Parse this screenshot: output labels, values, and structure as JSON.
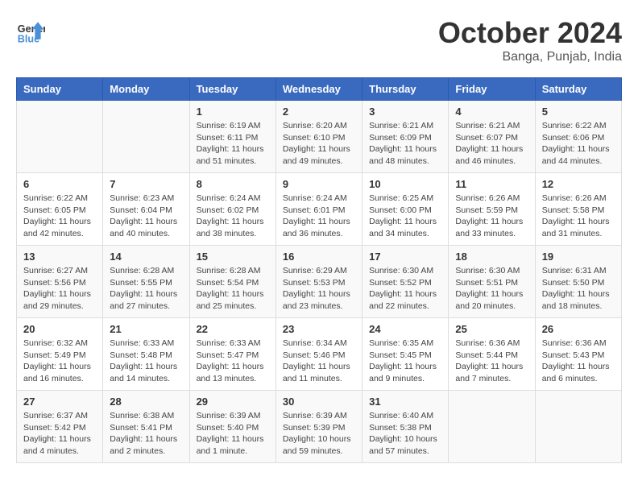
{
  "header": {
    "logo_line1": "General",
    "logo_line2": "Blue",
    "month": "October 2024",
    "location": "Banga, Punjab, India"
  },
  "weekdays": [
    "Sunday",
    "Monday",
    "Tuesday",
    "Wednesday",
    "Thursday",
    "Friday",
    "Saturday"
  ],
  "weeks": [
    [
      {
        "day": "",
        "sunrise": "",
        "sunset": "",
        "daylight": ""
      },
      {
        "day": "",
        "sunrise": "",
        "sunset": "",
        "daylight": ""
      },
      {
        "day": "1",
        "sunrise": "Sunrise: 6:19 AM",
        "sunset": "Sunset: 6:11 PM",
        "daylight": "Daylight: 11 hours and 51 minutes."
      },
      {
        "day": "2",
        "sunrise": "Sunrise: 6:20 AM",
        "sunset": "Sunset: 6:10 PM",
        "daylight": "Daylight: 11 hours and 49 minutes."
      },
      {
        "day": "3",
        "sunrise": "Sunrise: 6:21 AM",
        "sunset": "Sunset: 6:09 PM",
        "daylight": "Daylight: 11 hours and 48 minutes."
      },
      {
        "day": "4",
        "sunrise": "Sunrise: 6:21 AM",
        "sunset": "Sunset: 6:07 PM",
        "daylight": "Daylight: 11 hours and 46 minutes."
      },
      {
        "day": "5",
        "sunrise": "Sunrise: 6:22 AM",
        "sunset": "Sunset: 6:06 PM",
        "daylight": "Daylight: 11 hours and 44 minutes."
      }
    ],
    [
      {
        "day": "6",
        "sunrise": "Sunrise: 6:22 AM",
        "sunset": "Sunset: 6:05 PM",
        "daylight": "Daylight: 11 hours and 42 minutes."
      },
      {
        "day": "7",
        "sunrise": "Sunrise: 6:23 AM",
        "sunset": "Sunset: 6:04 PM",
        "daylight": "Daylight: 11 hours and 40 minutes."
      },
      {
        "day": "8",
        "sunrise": "Sunrise: 6:24 AM",
        "sunset": "Sunset: 6:02 PM",
        "daylight": "Daylight: 11 hours and 38 minutes."
      },
      {
        "day": "9",
        "sunrise": "Sunrise: 6:24 AM",
        "sunset": "Sunset: 6:01 PM",
        "daylight": "Daylight: 11 hours and 36 minutes."
      },
      {
        "day": "10",
        "sunrise": "Sunrise: 6:25 AM",
        "sunset": "Sunset: 6:00 PM",
        "daylight": "Daylight: 11 hours and 34 minutes."
      },
      {
        "day": "11",
        "sunrise": "Sunrise: 6:26 AM",
        "sunset": "Sunset: 5:59 PM",
        "daylight": "Daylight: 11 hours and 33 minutes."
      },
      {
        "day": "12",
        "sunrise": "Sunrise: 6:26 AM",
        "sunset": "Sunset: 5:58 PM",
        "daylight": "Daylight: 11 hours and 31 minutes."
      }
    ],
    [
      {
        "day": "13",
        "sunrise": "Sunrise: 6:27 AM",
        "sunset": "Sunset: 5:56 PM",
        "daylight": "Daylight: 11 hours and 29 minutes."
      },
      {
        "day": "14",
        "sunrise": "Sunrise: 6:28 AM",
        "sunset": "Sunset: 5:55 PM",
        "daylight": "Daylight: 11 hours and 27 minutes."
      },
      {
        "day": "15",
        "sunrise": "Sunrise: 6:28 AM",
        "sunset": "Sunset: 5:54 PM",
        "daylight": "Daylight: 11 hours and 25 minutes."
      },
      {
        "day": "16",
        "sunrise": "Sunrise: 6:29 AM",
        "sunset": "Sunset: 5:53 PM",
        "daylight": "Daylight: 11 hours and 23 minutes."
      },
      {
        "day": "17",
        "sunrise": "Sunrise: 6:30 AM",
        "sunset": "Sunset: 5:52 PM",
        "daylight": "Daylight: 11 hours and 22 minutes."
      },
      {
        "day": "18",
        "sunrise": "Sunrise: 6:30 AM",
        "sunset": "Sunset: 5:51 PM",
        "daylight": "Daylight: 11 hours and 20 minutes."
      },
      {
        "day": "19",
        "sunrise": "Sunrise: 6:31 AM",
        "sunset": "Sunset: 5:50 PM",
        "daylight": "Daylight: 11 hours and 18 minutes."
      }
    ],
    [
      {
        "day": "20",
        "sunrise": "Sunrise: 6:32 AM",
        "sunset": "Sunset: 5:49 PM",
        "daylight": "Daylight: 11 hours and 16 minutes."
      },
      {
        "day": "21",
        "sunrise": "Sunrise: 6:33 AM",
        "sunset": "Sunset: 5:48 PM",
        "daylight": "Daylight: 11 hours and 14 minutes."
      },
      {
        "day": "22",
        "sunrise": "Sunrise: 6:33 AM",
        "sunset": "Sunset: 5:47 PM",
        "daylight": "Daylight: 11 hours and 13 minutes."
      },
      {
        "day": "23",
        "sunrise": "Sunrise: 6:34 AM",
        "sunset": "Sunset: 5:46 PM",
        "daylight": "Daylight: 11 hours and 11 minutes."
      },
      {
        "day": "24",
        "sunrise": "Sunrise: 6:35 AM",
        "sunset": "Sunset: 5:45 PM",
        "daylight": "Daylight: 11 hours and 9 minutes."
      },
      {
        "day": "25",
        "sunrise": "Sunrise: 6:36 AM",
        "sunset": "Sunset: 5:44 PM",
        "daylight": "Daylight: 11 hours and 7 minutes."
      },
      {
        "day": "26",
        "sunrise": "Sunrise: 6:36 AM",
        "sunset": "Sunset: 5:43 PM",
        "daylight": "Daylight: 11 hours and 6 minutes."
      }
    ],
    [
      {
        "day": "27",
        "sunrise": "Sunrise: 6:37 AM",
        "sunset": "Sunset: 5:42 PM",
        "daylight": "Daylight: 11 hours and 4 minutes."
      },
      {
        "day": "28",
        "sunrise": "Sunrise: 6:38 AM",
        "sunset": "Sunset: 5:41 PM",
        "daylight": "Daylight: 11 hours and 2 minutes."
      },
      {
        "day": "29",
        "sunrise": "Sunrise: 6:39 AM",
        "sunset": "Sunset: 5:40 PM",
        "daylight": "Daylight: 11 hours and 1 minute."
      },
      {
        "day": "30",
        "sunrise": "Sunrise: 6:39 AM",
        "sunset": "Sunset: 5:39 PM",
        "daylight": "Daylight: 10 hours and 59 minutes."
      },
      {
        "day": "31",
        "sunrise": "Sunrise: 6:40 AM",
        "sunset": "Sunset: 5:38 PM",
        "daylight": "Daylight: 10 hours and 57 minutes."
      },
      {
        "day": "",
        "sunrise": "",
        "sunset": "",
        "daylight": ""
      },
      {
        "day": "",
        "sunrise": "",
        "sunset": "",
        "daylight": ""
      }
    ]
  ]
}
